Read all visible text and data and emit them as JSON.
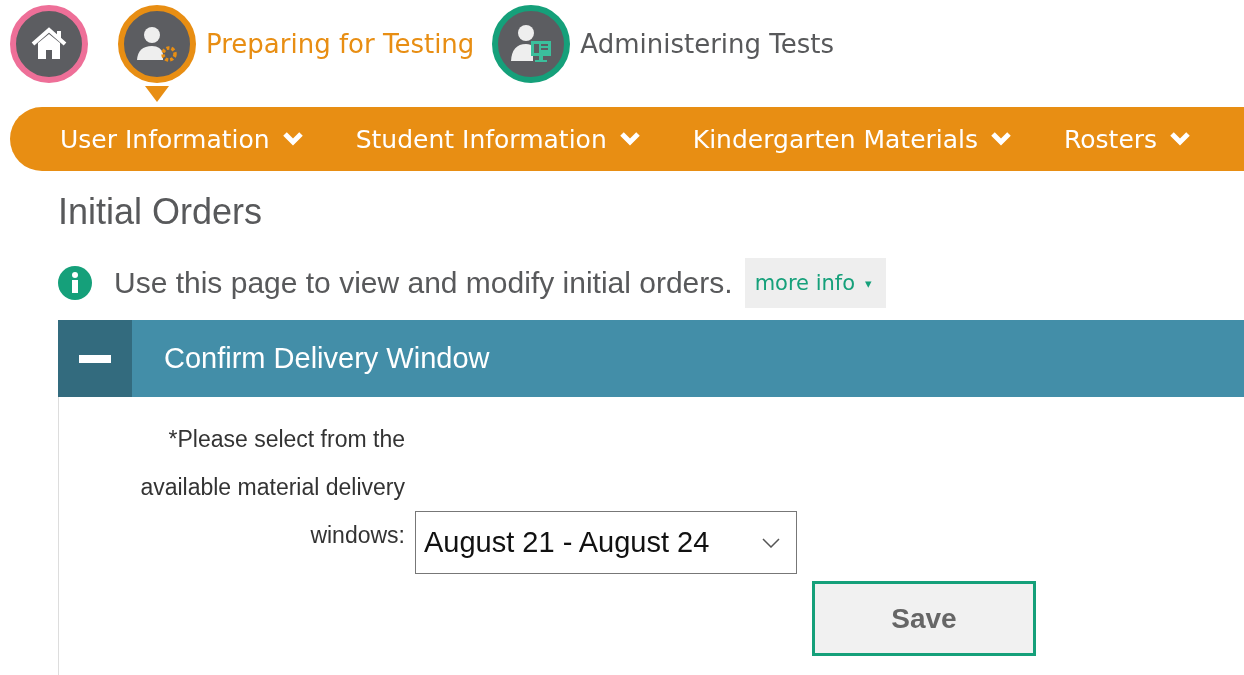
{
  "steps": [
    {
      "kind": "home",
      "selected": false,
      "color": "#ee6f98"
    },
    {
      "kind": "preparing",
      "label": "Preparing for Testing",
      "selected": true,
      "color": "#e88e13"
    },
    {
      "kind": "administering",
      "label": "Administering Tests",
      "selected": false,
      "color": "#15a07a"
    }
  ],
  "menu": [
    {
      "label": "User Information"
    },
    {
      "label": "Student Information"
    },
    {
      "label": "Kindergarten Materials"
    },
    {
      "label": "Rosters"
    }
  ],
  "page_title": "Initial Orders",
  "info": {
    "text": "Use this page to view and modify initial orders.",
    "more_info": "more info",
    "more_info_caret": "▾"
  },
  "panel": {
    "title": "Confirm Delivery Window",
    "expanded": true,
    "field_label": "*Please select from the available material delivery windows:",
    "select_value": "August 21 - August 24",
    "save": "Save"
  }
}
